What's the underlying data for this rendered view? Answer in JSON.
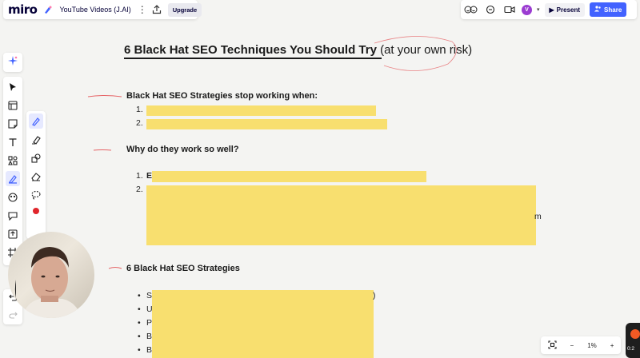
{
  "app": {
    "logo": "miro",
    "board_title": "YouTube Videos (J.AI)",
    "upgrade_label": "Upgrade",
    "avatar_initial": "V",
    "present_label": "Present",
    "share_label": "Share",
    "accent_color": "#4262ff"
  },
  "board": {
    "title_main": "6 Black Hat SEO Techniques You Should Try",
    "title_sub": "(at your own risk)",
    "section1": {
      "heading": "Black Hat SEO Strategies stop working when:",
      "markers": [
        "1.",
        "2."
      ]
    },
    "section2": {
      "heading": "Why do they work so well?",
      "markers": [
        "1.",
        "2."
      ],
      "visible_fragments": [
        "E",
        "m"
      ]
    },
    "section3": {
      "heading": "6 Black Hat SEO Strategies",
      "markers": [
        "•",
        "•",
        "•",
        "•",
        "•"
      ],
      "visible_fragments": [
        "S",
        "U",
        "P",
        "B",
        "B",
        ")"
      ]
    },
    "highlight_color": "#f8df6f"
  },
  "zoom": {
    "level": "1%",
    "minus": "−",
    "plus": "+"
  },
  "corner_widget_text": "0:2"
}
